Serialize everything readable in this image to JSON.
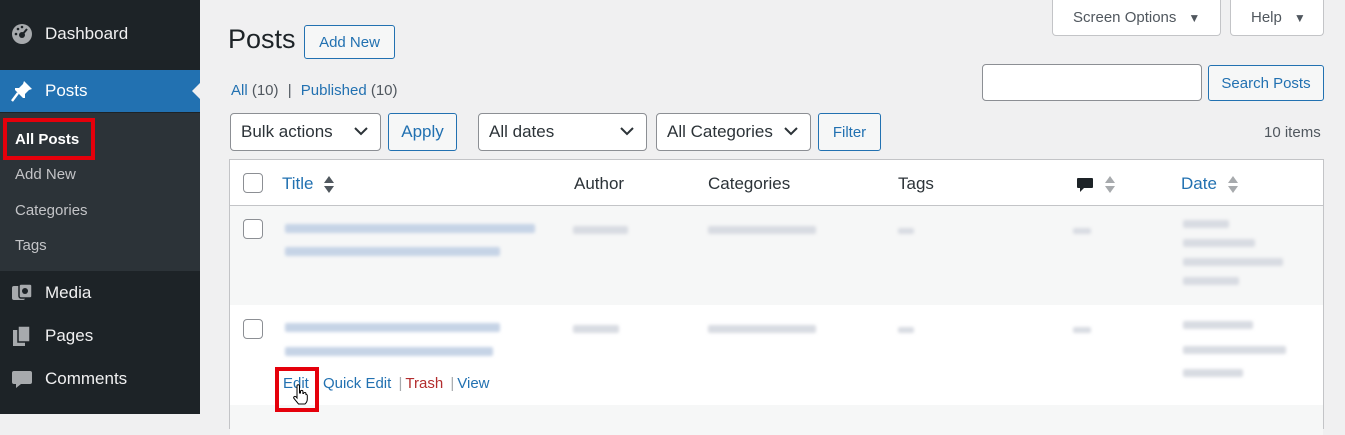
{
  "sidebar": {
    "dashboard": "Dashboard",
    "posts": "Posts",
    "sub_items": [
      "All Posts",
      "Add New",
      "Categories",
      "Tags"
    ],
    "media": "Media",
    "pages": "Pages",
    "comments": "Comments"
  },
  "header": {
    "screen_options": "Screen Options",
    "help": "Help",
    "title": "Posts",
    "add_new": "Add New"
  },
  "filters": {
    "all_label": "All",
    "all_count": "(10)",
    "published_label": "Published",
    "published_count": "(10)",
    "search_button": "Search Posts",
    "bulk_actions": "Bulk actions",
    "apply": "Apply",
    "all_dates": "All dates",
    "all_categories": "All Categories",
    "filter": "Filter",
    "items_count": "10 items"
  },
  "table": {
    "columns": {
      "title": "Title",
      "author": "Author",
      "categories": "Categories",
      "tags": "Tags",
      "date": "Date"
    }
  },
  "row_actions": {
    "edit": "Edit",
    "quick_edit": "Quick Edit",
    "trash": "Trash",
    "view": "View",
    "sep": "|"
  },
  "colors": {
    "sidebar_bg": "#1d2327",
    "accent": "#2271b1",
    "highlight": "#e5000b"
  }
}
